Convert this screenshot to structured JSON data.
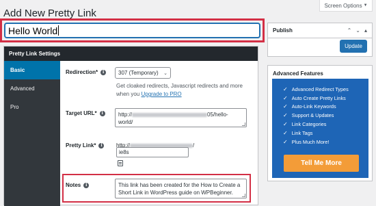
{
  "screen_options": {
    "label": "Screen Options"
  },
  "page": {
    "title": "Add New Pretty Link"
  },
  "title_input": {
    "value": "Hello World"
  },
  "settings": {
    "header": "Pretty Link Settings",
    "tabs": [
      {
        "label": "Basic",
        "active": true
      },
      {
        "label": "Advanced",
        "active": false
      },
      {
        "label": "Pro",
        "active": false
      }
    ],
    "redirection": {
      "label": "Redirection*",
      "selected": "307 (Temporary)",
      "help_text": "Get cloaked redirects, Javascript redirects and more when you ",
      "help_link": "Upgrade to PRO"
    },
    "target_url": {
      "label": "Target URL*",
      "prefix": "http://",
      "suffix_line1": "05/hello-",
      "line2": "world/"
    },
    "pretty_link": {
      "label": "Pretty Link*",
      "base": "http://",
      "base_end": "/",
      "slug": "ie8s"
    },
    "notes": {
      "label": "Notes",
      "value": "This link has been created for the How to Create a Short Link in WordPress guide on WPBeginner."
    }
  },
  "publish": {
    "title": "Publish",
    "update_label": "Update"
  },
  "advanced_features": {
    "title": "Advanced Features",
    "items": [
      "Advanced Redirect Types",
      "Auto Create Pretty Links",
      "Auto-Link Keywords",
      "Support & Updates",
      "Link Categories",
      "Link Tags",
      "Plus Much More!"
    ],
    "cta": "Tell Me More"
  },
  "colors": {
    "accent": "#2271b1",
    "highlight": "#d32f45",
    "feature_panel": "#1e65b6",
    "cta": "#f39c38",
    "sidebar": "#32373c",
    "header": "#23282d"
  }
}
